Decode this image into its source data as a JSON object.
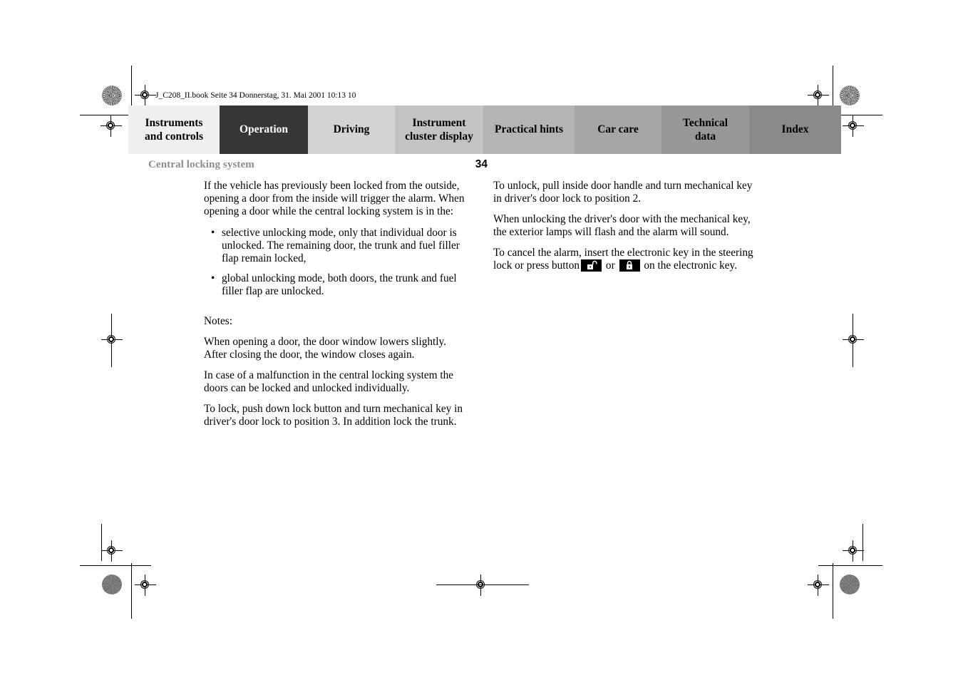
{
  "document": {
    "file_info": "J_C208_II.book  Seite 34  Donnerstag, 31. Mai 2001  10:13 10",
    "running_head": "Central locking system",
    "page_number": "34"
  },
  "tabs": [
    {
      "label": "Instruments and controls",
      "line1": "Instruments",
      "line2": "and controls",
      "color": "#efefee",
      "active": false
    },
    {
      "label": "Operation",
      "line1": "Operation",
      "line2": "",
      "color": "#363636",
      "active": true
    },
    {
      "label": "Driving",
      "line1": "Driving",
      "line2": "",
      "color": "#d3d3d3",
      "active": false
    },
    {
      "label": "Instrument cluster display",
      "line1": "Instrument",
      "line2": "cluster display",
      "color": "#c3c3c3",
      "active": false
    },
    {
      "label": "Practical hints",
      "line1": "Practical hints",
      "line2": "",
      "color": "#b4b4b4",
      "active": false
    },
    {
      "label": "Car care",
      "line1": "Car care",
      "line2": "",
      "color": "#a6a6a6",
      "active": false
    },
    {
      "label": "Technical data",
      "line1": "Technical",
      "line2": "data",
      "color": "#989898",
      "active": false
    },
    {
      "label": "Index",
      "line1": "Index",
      "line2": "",
      "color": "#8a8a8a",
      "active": false
    }
  ],
  "content": {
    "left_column": {
      "intro": "If the vehicle has previously been locked from the outside, opening a door from the inside will trigger the alarm. When opening a door while the central locking system is in the:",
      "bullet_marker": "•",
      "bullets": [
        "selective unlocking mode, only that individual door is unlocked. The remaining door, the trunk and fuel filler flap remain locked,",
        "global unlocking mode, both doors, the trunk and fuel filler flap are unlocked."
      ],
      "notes_label": "Notes:",
      "note_1": "When opening a door, the door window lowers slightly. After closing the door, the window closes again.",
      "note_2": "In case of a malfunction in the central locking system the doors can be locked and unlocked individually.",
      "note_3": "To lock, push down lock button and turn mechanical key in driver's door lock to position 3. In addition lock the trunk."
    },
    "right_column": {
      "para_1": "To unlock, pull inside door handle and turn mechanical key in driver's door lock to position 2.",
      "para_2": "When unlocking the driver's door with the mechanical key, the exterior lamps will flash and the alarm will sound.",
      "para_3_before": "To cancel the alarm, insert the electronic key in the steering lock or press button",
      "para_3_conjunction": "or",
      "para_3_after": "on the electronic key.",
      "icon_unlock_name": "unlock-padlock-icon",
      "icon_lock_name": "lock-padlock-icon"
    }
  }
}
